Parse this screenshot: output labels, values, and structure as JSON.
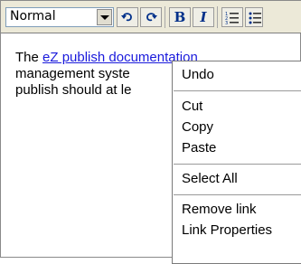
{
  "toolbar": {
    "style_select": {
      "value": "Normal"
    },
    "buttons": [
      {
        "name": "undo-button",
        "icon": "undo-icon"
      },
      {
        "name": "redo-button",
        "icon": "redo-icon"
      },
      {
        "name": "bold-button",
        "label": "B"
      },
      {
        "name": "italic-button",
        "label": "I"
      },
      {
        "name": "ordered-list-button",
        "icon": "ordered-list-icon"
      },
      {
        "name": "unordered-list-button",
        "icon": "unordered-list-icon"
      }
    ]
  },
  "editor": {
    "line1_prefix": "The ",
    "link_text": "eZ publish doc",
    "line1_rest": "umentation",
    "line2": "management syste",
    "line3": "publish should at le"
  },
  "context_menu": {
    "items": [
      "Undo",
      "Cut",
      "Copy",
      "Paste",
      "Select All",
      "Remove link",
      "Link Properties"
    ]
  },
  "colors": {
    "link": "#1a1adc",
    "toolbar_bg": "#ece9d8",
    "icon_blue": "#00308a"
  }
}
